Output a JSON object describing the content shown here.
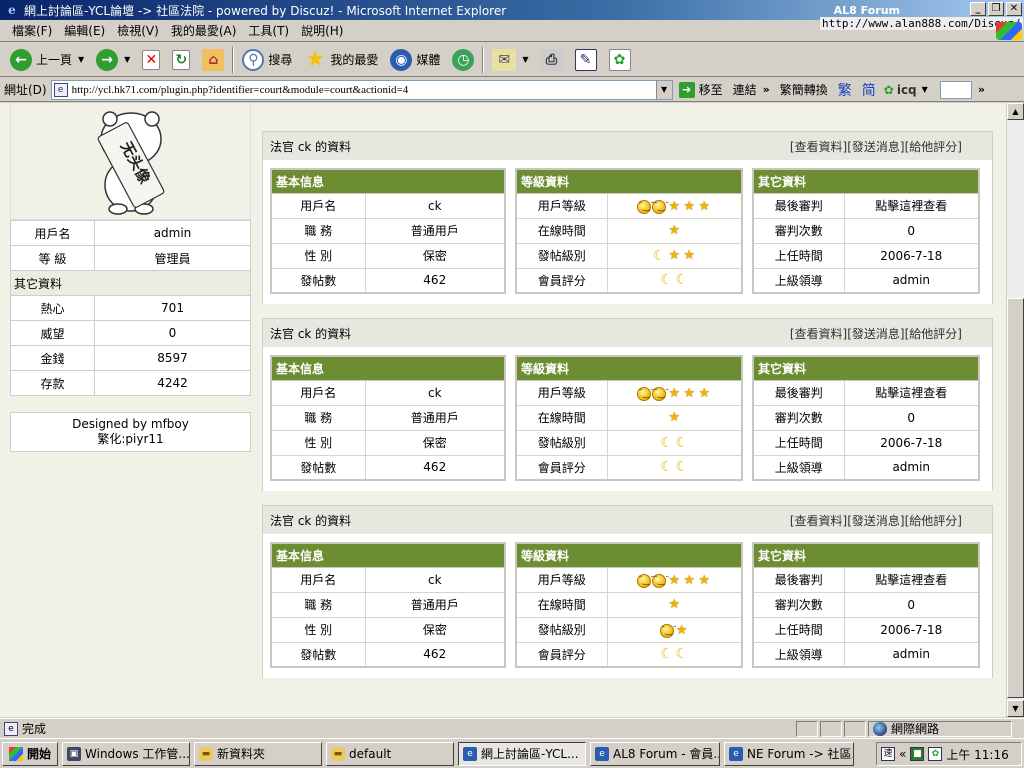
{
  "window": {
    "title": "網上討論區-YCL論壇 -> 社區法院 - powered by Discuz! - Microsoft Internet Explorer",
    "brand_name": "AL8 Forum",
    "brand_url": "http://www.alan888.com/Discuz/"
  },
  "menu": [
    "檔案(F)",
    "編輯(E)",
    "檢視(V)",
    "我的最愛(A)",
    "工具(T)",
    "說明(H)"
  ],
  "toolbar": {
    "back": "上一頁",
    "search": "搜尋",
    "favorites": "我的最愛",
    "media": "媒體"
  },
  "address": {
    "label": "網址(D)",
    "url": "http://ycl.hk71.com/plugin.php?identifier=court&module=court&actionid=4",
    "go": "移至",
    "links": "連結",
    "convert": "繁簡轉換",
    "trad": "繁",
    "simp": "简",
    "icq": "icq"
  },
  "sidebar": {
    "avatar_text": "无头像",
    "rows": [
      {
        "label": "用戶名",
        "value": "admin"
      },
      {
        "label": "等  級",
        "value": "管理員"
      }
    ],
    "section": "其它資料",
    "extra_rows": [
      {
        "label": "熱心",
        "value": "701"
      },
      {
        "label": "威望",
        "value": "0"
      },
      {
        "label": "金錢",
        "value": "8597"
      },
      {
        "label": "存款",
        "value": "4242"
      }
    ],
    "designed_by": "Designed by mfboy",
    "translated_by": "繁化:piyr11"
  },
  "panels": [
    {
      "title": "法官 ck 的資料",
      "links": [
        "[查看資料]",
        "[發送消息]",
        "[給他評分]"
      ],
      "basic_header": "基本信息",
      "basic": [
        {
          "label": "用戶名",
          "value": "ck"
        },
        {
          "label": "職  務",
          "value": "普通用戶"
        },
        {
          "label": "性  別",
          "value": "保密"
        },
        {
          "label": "發帖數",
          "value": "462"
        }
      ],
      "level_header": "等級資料",
      "level": [
        {
          "label": "用戶等級",
          "icons": [
            "sun",
            "sun",
            "star",
            "star",
            "star"
          ]
        },
        {
          "label": "在線時間",
          "icons": [
            "star"
          ]
        },
        {
          "label": "發帖級別",
          "icons": [
            "moon",
            "star",
            "star"
          ]
        },
        {
          "label": "會員評分",
          "icons": [
            "moon",
            "moon"
          ]
        }
      ],
      "other_header": "其它資料",
      "other": [
        {
          "label": "最後審判",
          "value": "點擊這裡查看"
        },
        {
          "label": "審判次數",
          "value": "0"
        },
        {
          "label": "上任時間",
          "value": "2006-7-18"
        },
        {
          "label": "上級領導",
          "value": "admin"
        }
      ]
    },
    {
      "title": "法官 ck 的資料",
      "links": [
        "[查看資料]",
        "[發送消息]",
        "[給他評分]"
      ],
      "basic_header": "基本信息",
      "basic": [
        {
          "label": "用戶名",
          "value": "ck"
        },
        {
          "label": "職  務",
          "value": "普通用戶"
        },
        {
          "label": "性  別",
          "value": "保密"
        },
        {
          "label": "發帖數",
          "value": "462"
        }
      ],
      "level_header": "等級資料",
      "level": [
        {
          "label": "用戶等級",
          "icons": [
            "sun",
            "sun",
            "star",
            "star",
            "star"
          ]
        },
        {
          "label": "在線時間",
          "icons": [
            "star"
          ]
        },
        {
          "label": "發帖級別",
          "icons": [
            "moon",
            "moon"
          ]
        },
        {
          "label": "會員評分",
          "icons": [
            "moon",
            "moon"
          ]
        }
      ],
      "other_header": "其它資料",
      "other": [
        {
          "label": "最後審判",
          "value": "點擊這裡查看"
        },
        {
          "label": "審判次數",
          "value": "0"
        },
        {
          "label": "上任時間",
          "value": "2006-7-18"
        },
        {
          "label": "上級領導",
          "value": "admin"
        }
      ]
    },
    {
      "title": "法官 ck 的資料",
      "links": [
        "[查看資料]",
        "[發送消息]",
        "[給他評分]"
      ],
      "basic_header": "基本信息",
      "basic": [
        {
          "label": "用戶名",
          "value": "ck"
        },
        {
          "label": "職  務",
          "value": "普通用戶"
        },
        {
          "label": "性  別",
          "value": "保密"
        },
        {
          "label": "發帖數",
          "value": "462"
        }
      ],
      "level_header": "等級資料",
      "level": [
        {
          "label": "用戶等級",
          "icons": [
            "sun",
            "sun",
            "star",
            "star",
            "star"
          ]
        },
        {
          "label": "在線時間",
          "icons": [
            "star"
          ]
        },
        {
          "label": "發帖級別",
          "icons": [
            "sun",
            "star"
          ]
        },
        {
          "label": "會員評分",
          "icons": [
            "moon",
            "moon"
          ]
        }
      ],
      "other_header": "其它資料",
      "other": [
        {
          "label": "最後審判",
          "value": "點擊這裡查看"
        },
        {
          "label": "審判次數",
          "value": "0"
        },
        {
          "label": "上任時間",
          "value": "2006-7-18"
        },
        {
          "label": "上級領導",
          "value": "admin"
        }
      ]
    }
  ],
  "status": {
    "text": "完成",
    "zone": "網際網路"
  },
  "taskbar": {
    "start": "開始",
    "items": [
      {
        "label": "Windows 工作管...",
        "icon": "win"
      },
      {
        "label": "新資料夾",
        "icon": "folder"
      },
      {
        "label": "default",
        "icon": "folder"
      },
      {
        "label": "網上討論區-YCL...",
        "icon": "ie",
        "active": true
      },
      {
        "label": "AL8 Forum - 會員...",
        "icon": "ie"
      },
      {
        "label": "NE Forum -> 社區...",
        "icon": "ie"
      }
    ],
    "clock": "上午 11:16"
  }
}
